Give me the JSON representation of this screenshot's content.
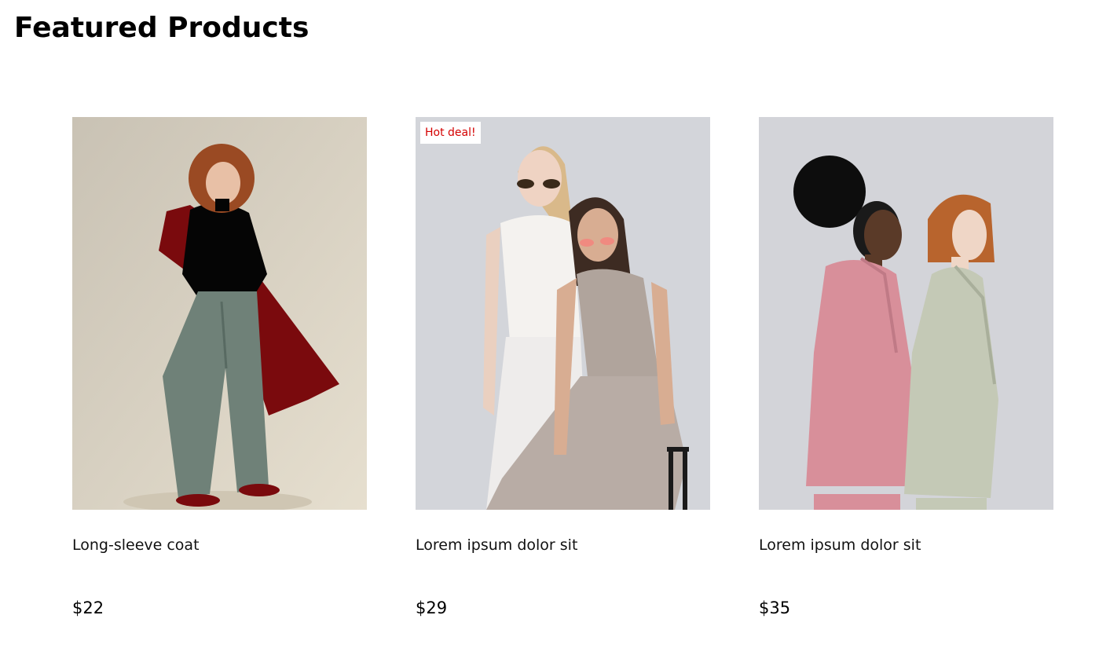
{
  "page": {
    "title": "Featured Products"
  },
  "products": [
    {
      "name": "Long-sleeve coat",
      "price": "$22",
      "badge": "",
      "image_icon": "product-photo-woman-red-coat"
    },
    {
      "name": "Lorem ipsum dolor sit",
      "price": "$29",
      "badge": "Hot deal!",
      "image_icon": "product-photo-two-women-knitwear"
    },
    {
      "name": "Lorem ipsum dolor sit",
      "price": "$35",
      "badge": "",
      "image_icon": "product-photo-two-women-blazers"
    }
  ],
  "colors": {
    "badge_text": "#d40000",
    "badge_background": "#ffffff",
    "text": "#111111"
  }
}
